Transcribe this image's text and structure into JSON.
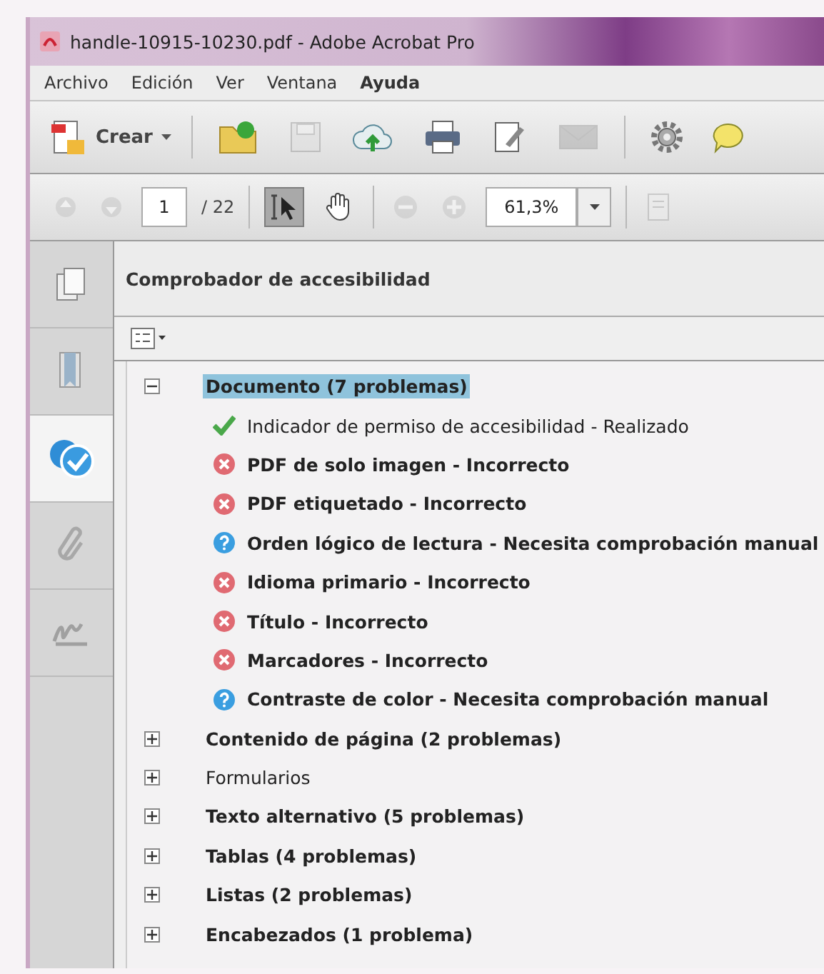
{
  "window": {
    "title": "handle-10915-10230.pdf - Adobe Acrobat Pro"
  },
  "menu": [
    "Archivo",
    "Edición",
    "Ver",
    "Ventana",
    "Ayuda"
  ],
  "toolbar": [
    {
      "kind": "create",
      "label": "Crear",
      "disabled": false
    },
    {
      "kind": "open",
      "disabled": false
    },
    {
      "kind": "save",
      "disabled": true
    },
    {
      "kind": "upload",
      "disabled": false
    },
    {
      "kind": "print",
      "disabled": false
    },
    {
      "kind": "edit",
      "disabled": false
    },
    {
      "kind": "mail",
      "disabled": true
    },
    {
      "kind": "gear",
      "disabled": false
    },
    {
      "kind": "comment",
      "disabled": false
    }
  ],
  "navigation": {
    "page": "1",
    "page_count": "/ 22",
    "zoom": "61,3%",
    "tools": [
      {
        "kind": "select",
        "selected": true
      },
      {
        "kind": "hand",
        "selected": false
      }
    ]
  },
  "sidebar": [
    {
      "kind": "pages",
      "selected": false
    },
    {
      "kind": "bookmarks",
      "selected": false
    },
    {
      "kind": "accessibility",
      "selected": true
    },
    {
      "kind": "attachments",
      "selected": false
    },
    {
      "kind": "signatures",
      "selected": false
    }
  ],
  "panel": {
    "title": "Comprobador de accesibilidad",
    "tree": [
      {
        "label": "Documento (7 problemas)",
        "flagged": true,
        "expanded": true,
        "selected": true,
        "children": [
          {
            "label": "Indicador de permiso de accesibilidad - Realizado",
            "kind": "pass"
          },
          {
            "label": "PDF de solo imagen - Incorrecto",
            "kind": "fail"
          },
          {
            "label": "PDF etiquetado - Incorrecto",
            "kind": "fail"
          },
          {
            "label": "Orden lógico de lectura - Necesita comprobación manual",
            "kind": "manual"
          },
          {
            "label": "Idioma primario - Incorrecto",
            "kind": "fail"
          },
          {
            "label": "Título - Incorrecto",
            "kind": "fail"
          },
          {
            "label": "Marcadores - Incorrecto",
            "kind": "fail"
          },
          {
            "label": "Contraste de color - Necesita comprobación manual",
            "kind": "manual"
          }
        ]
      },
      {
        "label": "Contenido de página (2 problemas)",
        "flagged": true,
        "expanded": false,
        "selected": false
      },
      {
        "label": "Formularios",
        "flagged": false,
        "expanded": false,
        "selected": false
      },
      {
        "label": "Texto alternativo (5 problemas)",
        "flagged": true,
        "expanded": false,
        "selected": false
      },
      {
        "label": "Tablas (4 problemas)",
        "flagged": true,
        "expanded": false,
        "selected": false
      },
      {
        "label": "Listas (2 problemas)",
        "flagged": true,
        "expanded": false,
        "selected": false
      },
      {
        "label": "Encabezados (1 problema)",
        "flagged": true,
        "expanded": false,
        "selected": false
      }
    ]
  }
}
